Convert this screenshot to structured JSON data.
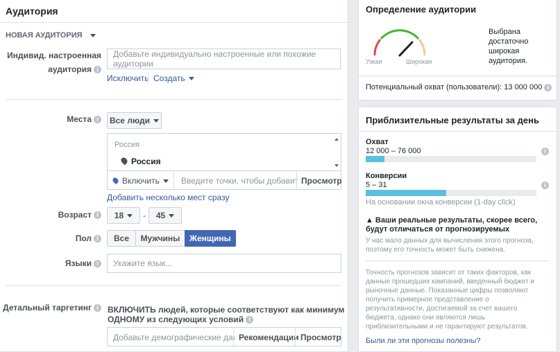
{
  "left": {
    "title": "Аудитория",
    "new_audience": "НОВАЯ АУДИТОРИЯ",
    "custom_label_1": "Индивид. настроенная",
    "custom_label_2": "аудитория",
    "custom_placeholder": "Добавьте индивидуально настроенные или похожие аудитории",
    "exclude": "Исключить",
    "create": "Создать",
    "places_label": "Места",
    "everyone_btn": "Все люди",
    "country_header": "Россия",
    "country_selected": "Россия",
    "include_btn": "Включить",
    "places_placeholder": "Введите точки, чтобы добавить их",
    "browse": "Просмотр",
    "add_multiple": "Добавить несколько мест сразу",
    "age_label": "Возраст",
    "age_from": "18",
    "age_sep": "-",
    "age_to": "45",
    "gender_label": "Пол",
    "gender_all": "Все",
    "gender_men": "Мужчины",
    "gender_women": "Женщины",
    "languages_label": "Языки",
    "languages_placeholder": "Укажите язык...",
    "detailed_label": "Детальный таргетинг",
    "detailed_text_1": "ВКЛЮЧИТЬ людей, которые соответствуют как минимум",
    "detailed_text_2": "ОДНОМУ из следующих условий",
    "detailed_placeholder": "Добавьте демографические дан...",
    "recommendations": "Рекомендации",
    "browse2": "Просмотр"
  },
  "definition": {
    "title": "Определение аудитории",
    "narrow": "Узкая",
    "wide": "Широкая",
    "desc": [
      "Выбрана",
      "достаточно",
      "широкая",
      "аудитория."
    ],
    "potential": "Потенциальный охват (пользователи): 13 000 000"
  },
  "results": {
    "title": "Приблизительные результаты за день",
    "reach_label": "Охват",
    "reach_value": "12 000 – 76 000",
    "reach_fill": 0.11,
    "conv_label": "Конверсии",
    "conv_value": "5 – 31",
    "conv_fill": 0.47,
    "conv_note": "На основании окна конверсии (1-day click)",
    "warn_title_1": "Ваши реальные результаты, скорее всего,",
    "warn_title_2": "будут отличаться от прогнозируемых",
    "warn_text": [
      "У нас мало данных для вычисления этого прогноза,",
      "поэтому его точность может быть снижена."
    ],
    "accuracy_text": [
      "Точность прогнозов зависит от таких факторов, как",
      "данные прошедших кампаний, введенный бюджет и",
      "рыночные данные. Показанные цифры позволяют",
      "получить примерное представление о",
      "результативности, достигаемой за счет вашего",
      "бюджета, однако они являются лишь",
      "приблизительными и не гарантируют результатов."
    ],
    "feedback": "Были ли эти прогнозы полезны?"
  },
  "colors": {
    "accent": "#4267b2",
    "link": "#365899",
    "bar": "#5bc0de"
  }
}
